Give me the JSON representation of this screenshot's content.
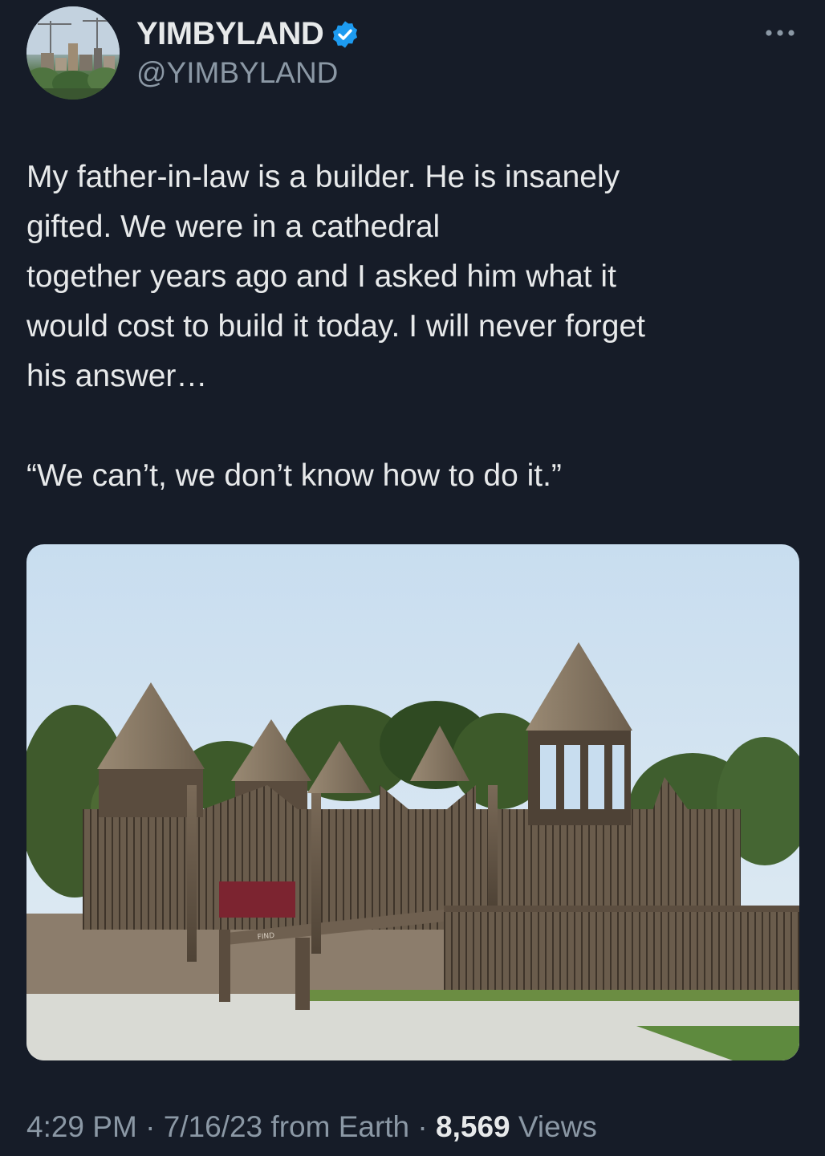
{
  "author": {
    "display_name": "YIMBYLAND",
    "handle": "@YIMBYLAND",
    "verified": true,
    "avatar_icon": "city-skyline-avatar"
  },
  "tweet": {
    "lines": [
      "My father-in-law is a builder. He is insanely",
      "gifted. We were in a cathedral",
      "together years ago and I asked him what it",
      "would cost to build it today. I will never forget",
      "his answer…",
      "“We can’t, we don’t know how to do it.”"
    ],
    "media_sign_text": "FIND"
  },
  "meta": {
    "time": "4:29 PM",
    "separator": "·",
    "date": "7/16/23",
    "source": "from Earth",
    "views_count": "8,569",
    "views_label": "Views"
  },
  "colors": {
    "background": "#161c28",
    "text_primary": "#e7e9ea",
    "text_secondary": "#8b98a5",
    "verified_blue": "#1d9bf0"
  }
}
